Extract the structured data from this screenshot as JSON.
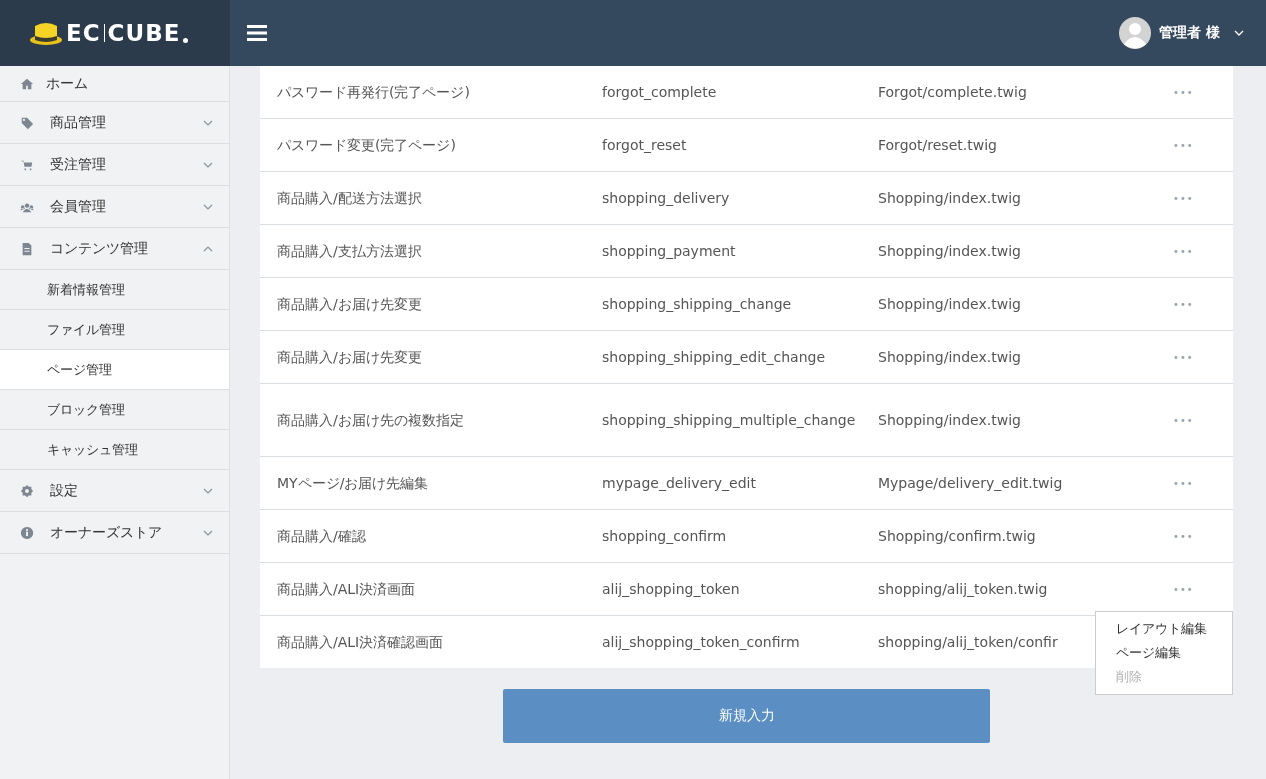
{
  "header": {
    "logo": {
      "left": "EC",
      "right": "CUBE"
    },
    "user": "管理者 様"
  },
  "sidebar": {
    "items": [
      {
        "label": "ホーム",
        "kind": "top",
        "selected": false
      },
      {
        "label": "商品管理",
        "kind": "top",
        "expanded": false,
        "selected": false
      },
      {
        "label": "受注管理",
        "kind": "top",
        "expanded": false,
        "selected": false
      },
      {
        "label": "会員管理",
        "kind": "top",
        "expanded": false,
        "selected": false
      },
      {
        "label": "コンテンツ管理",
        "kind": "top",
        "expanded": true,
        "selected": false
      },
      {
        "label": "新着情報管理",
        "kind": "sub",
        "selected": false
      },
      {
        "label": "ファイル管理",
        "kind": "sub",
        "selected": false
      },
      {
        "label": "ページ管理",
        "kind": "sub",
        "selected": true
      },
      {
        "label": "ブロック管理",
        "kind": "sub",
        "selected": false
      },
      {
        "label": "キャッシュ管理",
        "kind": "sub",
        "selected": false
      },
      {
        "label": "設定",
        "kind": "top",
        "expanded": false,
        "selected": false
      },
      {
        "label": "オーナーズストア",
        "kind": "top",
        "expanded": false,
        "selected": false
      }
    ]
  },
  "table": {
    "rows": [
      {
        "name": "パスワード再発行(完了ページ)",
        "url": "forgot_complete",
        "file": "Forgot/complete.twig",
        "actions": "•••"
      },
      {
        "name": "パスワード変更(完了ページ)",
        "url": "forgot_reset",
        "file": "Forgot/reset.twig",
        "actions": "•••"
      },
      {
        "name": "商品購入/配送方法選択",
        "url": "shopping_delivery",
        "file": "Shopping/index.twig",
        "actions": "•••"
      },
      {
        "name": "商品購入/支払方法選択",
        "url": "shopping_payment",
        "file": "Shopping/index.twig",
        "actions": "•••"
      },
      {
        "name": "商品購入/お届け先変更",
        "url": "shopping_shipping_change",
        "file": "Shopping/index.twig",
        "actions": "•••"
      },
      {
        "name": "商品購入/お届け先変更",
        "url": "shopping_shipping_edit_change",
        "file": "Shopping/index.twig",
        "actions": "•••"
      },
      {
        "name": "商品購入/お届け先の複数指定",
        "url": "shopping_shipping_multiple_change",
        "file": "Shopping/index.twig",
        "actions": "•••"
      },
      {
        "name": "MYページ/お届け先編集",
        "url": "mypage_delivery_edit",
        "file": "Mypage/delivery_edit.twig",
        "actions": "•••"
      },
      {
        "name": "商品購入/確認",
        "url": "shopping_confirm",
        "file": "Shopping/confirm.twig",
        "actions": "•••"
      },
      {
        "name": "商品購入/ALI決済画面",
        "url": "alij_shopping_token",
        "file": "shopping/alij_token.twig",
        "actions": "•••"
      },
      {
        "name": "商品購入/ALI決済確認画面",
        "url": "alij_shopping_token_confirm",
        "file": "shopping/alij_token/confir"
      }
    ]
  },
  "context_menu": {
    "items": [
      {
        "label": "レイアウト編集",
        "disabled": false
      },
      {
        "label": "ページ編集",
        "disabled": false
      },
      {
        "label": "削除",
        "disabled": true
      }
    ]
  },
  "new_button": "新規入力"
}
